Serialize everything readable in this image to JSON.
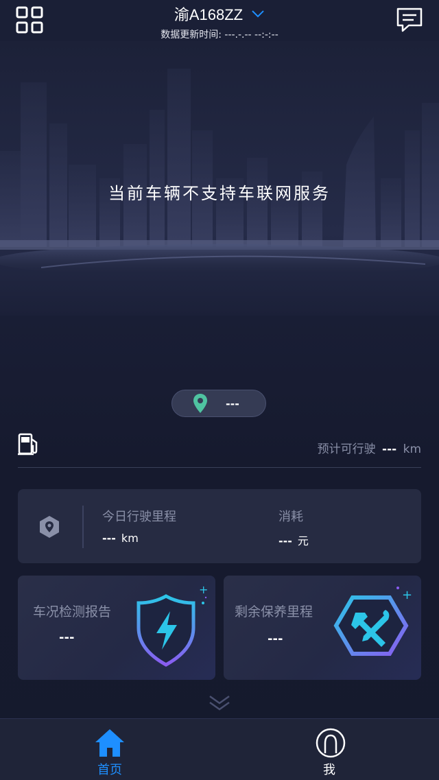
{
  "header": {
    "plate": "渝A168ZZ",
    "update_time": "数据更新时间: ---.-.-- --:-:--"
  },
  "hero": {
    "message": "当前车辆不支持车联网服务"
  },
  "location": {
    "value": "---"
  },
  "fuel": {
    "range_label": "预计可行驶",
    "range_value": "---",
    "range_unit": "km"
  },
  "mileage": {
    "today_label": "今日行驶里程",
    "today_value": "---",
    "today_unit": "km",
    "cost_label": "消耗",
    "cost_value": "---",
    "cost_unit": "元"
  },
  "cards": {
    "inspection_title": "车况检测报告",
    "inspection_value": "---",
    "maintenance_title": "剩余保养里程",
    "maintenance_value": "---"
  },
  "tabs": {
    "home_label": "首页",
    "me_label": "我"
  },
  "colors": {
    "accent": "#1e8fff",
    "background": "#161a2e",
    "card": "#262b42",
    "muted_text": "#8a90a8",
    "pin": "#4fc3a1"
  },
  "icons": [
    "grid-menu-icon",
    "message-icon",
    "chevron-down-icon",
    "location-pin-icon",
    "fuel-pump-icon",
    "mileage-location-icon",
    "shield-bolt-icon",
    "tools-hexagon-icon",
    "double-chevron-down-icon",
    "home-icon",
    "user-icon"
  ]
}
